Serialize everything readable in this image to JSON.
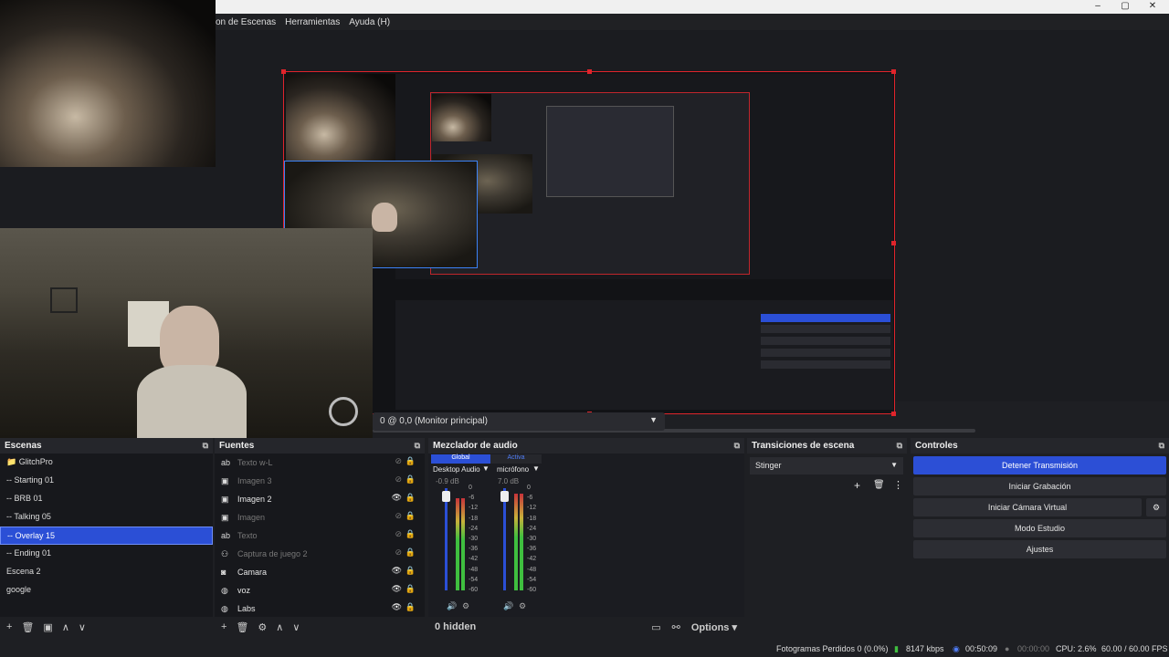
{
  "window": {
    "minimize": "–",
    "maximize": "▢",
    "close": "✕"
  },
  "menu": [
    "on de Escenas",
    "Herramientas",
    "Ayuda (H)"
  ],
  "preview": {
    "monitor_label": "0 @ 0,0 (Monitor principal)"
  },
  "scenes": {
    "title": "Escenas",
    "items": [
      "GlitchPro",
      "-- Starting 01",
      "-- BRB 01",
      "-- Talking 05",
      "-- Overlay 15",
      "-- Ending 01",
      "Escena 2",
      "google"
    ],
    "selected_index": 4
  },
  "sources": {
    "title": "Fuentes",
    "items": [
      {
        "label": "Texto w-L",
        "icon": "text-icon",
        "visible": false
      },
      {
        "label": "Imagen 3",
        "icon": "image-icon",
        "visible": false
      },
      {
        "label": "Imagen 2",
        "icon": "image-icon",
        "visible": true
      },
      {
        "label": "Imagen",
        "icon": "image-icon",
        "visible": false
      },
      {
        "label": "Texto",
        "icon": "text-icon",
        "visible": false
      },
      {
        "label": "Captura de juego 2",
        "icon": "gamepad-icon",
        "visible": false
      },
      {
        "label": "Camara",
        "icon": "camera-icon",
        "visible": true
      },
      {
        "label": "voz",
        "icon": "globe-icon",
        "visible": true
      },
      {
        "label": "Labs",
        "icon": "globe-icon",
        "visible": true
      }
    ]
  },
  "mixer": {
    "title": "Mezclador de audio",
    "tab_global": "Global",
    "tab_active": "Activa",
    "channels": [
      {
        "name": "Desktop Audio",
        "db": "-0.9 dB",
        "level": 0.9
      },
      {
        "name": "micrófono",
        "db": "7.0 dB",
        "level": 0.95
      }
    ],
    "scale": [
      "0",
      "-6",
      "-12",
      "-18",
      "-24",
      "-30",
      "-36",
      "-42",
      "-48",
      "-54",
      "-60"
    ],
    "hidden": "0 hidden",
    "options": "Options"
  },
  "transitions": {
    "title": "Transiciones de escena",
    "selected": "Stinger"
  },
  "controls": {
    "title": "Controles",
    "stop_stream": "Detener Transmisión",
    "start_record": "Iniciar Grabación",
    "start_vcam": "Iniciar Cámara Virtual",
    "studio_mode": "Modo Estudio",
    "settings": "Ajustes"
  },
  "status": {
    "dropped": "Fotogramas Perdidos 0 (0.0%)",
    "bitrate": "8147 kbps",
    "stream_time": "00:50:09",
    "record_time": "00:00:00",
    "cpu": "CPU: 2.6%",
    "fps": "60.00 / 60.00 FPS"
  },
  "colors": {
    "accent": "#2b4fd6",
    "canvas_border": "#e0242b",
    "meter_green": "#3fbf3f",
    "meter_yellow": "#c8b13a",
    "meter_red": "#c8323a"
  }
}
